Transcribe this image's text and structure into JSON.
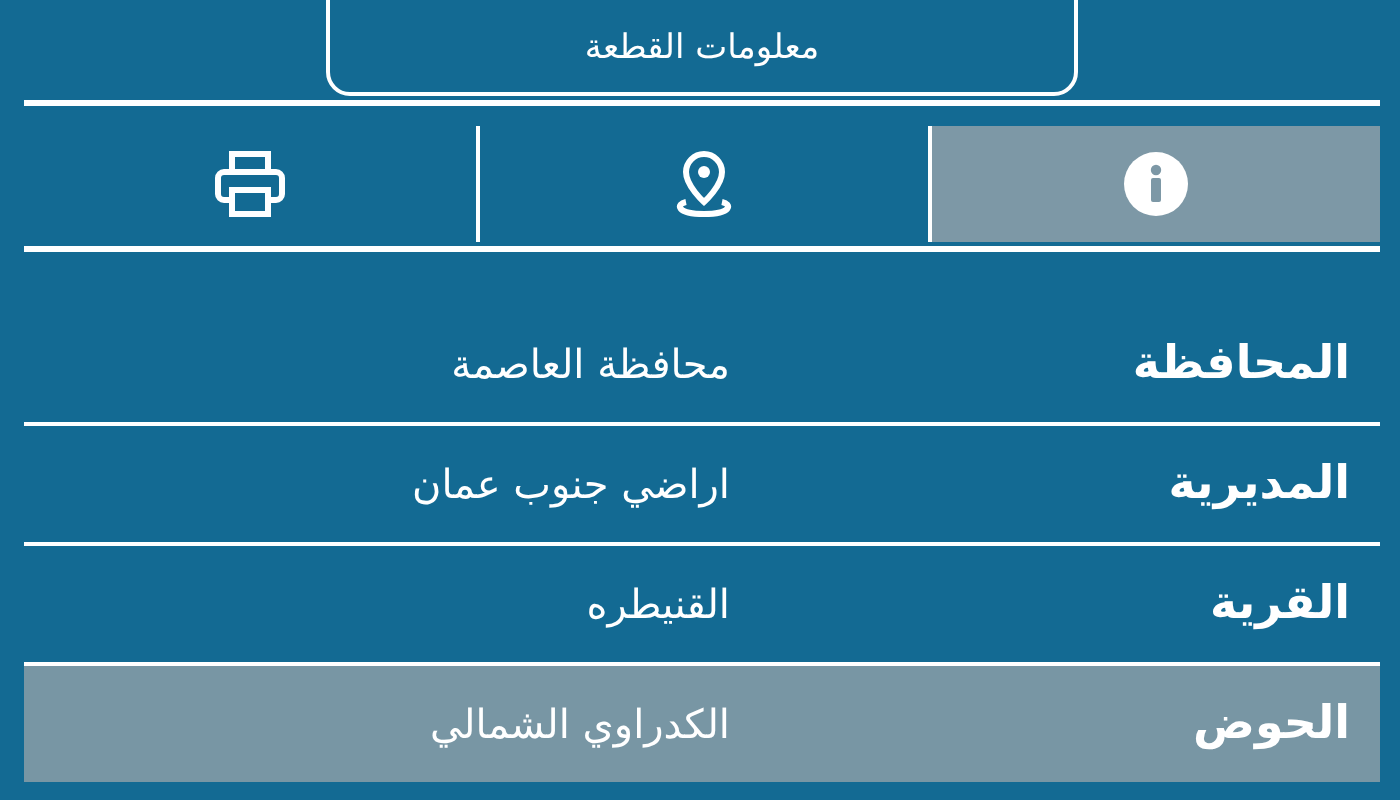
{
  "header_button": {
    "label": "معلومات القطعة"
  },
  "tabs": [
    {
      "kind": "info",
      "selected": true
    },
    {
      "kind": "location",
      "selected": false
    },
    {
      "kind": "print",
      "selected": false
    }
  ],
  "rows": [
    {
      "label": "المحافظة",
      "value": "محافظة العاصمة",
      "selected": false
    },
    {
      "label": "المديرية",
      "value": "اراضي جنوب عمان",
      "selected": false
    },
    {
      "label": "القرية",
      "value": "القنيطره",
      "selected": false
    },
    {
      "label": "الحوض",
      "value": "الكدراوي الشمالي",
      "selected": true
    }
  ]
}
